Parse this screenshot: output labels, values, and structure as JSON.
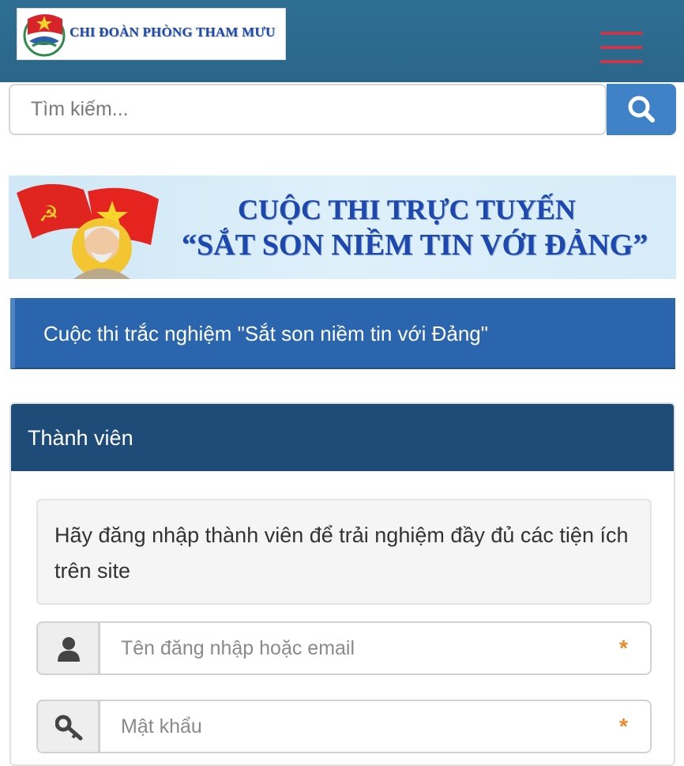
{
  "header": {
    "logo_text": "CHI ĐOÀN PHÒNG THAM MƯU",
    "menu_icon": "hamburger-icon",
    "accent_color": "#2e6f93"
  },
  "search": {
    "placeholder": "Tìm kiếm...",
    "button_icon": "search-icon"
  },
  "banner": {
    "line1": "CUỘC THI TRỰC TUYẾN",
    "line2": "“SẮT SON NIỀM TIN VỚI ĐẢNG”"
  },
  "page_title": "Cuộc thi trắc nghiệm \"Sắt son niềm tin với Đảng\"",
  "member_panel": {
    "title": "Thành viên",
    "notice": "Hãy đăng nhập thành viên để trải nghiệm đầy đủ các tiện ích trên site",
    "username": {
      "placeholder": "Tên đăng nhập hoặc email",
      "icon": "user-icon",
      "required_mark": "*"
    },
    "password": {
      "placeholder": "Mật khẩu",
      "icon": "key-icon",
      "required_mark": "*"
    }
  }
}
